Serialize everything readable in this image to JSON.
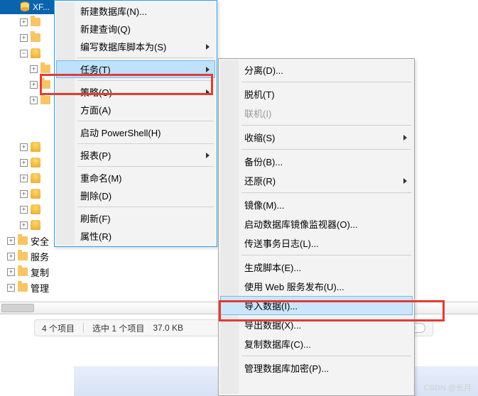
{
  "tree": {
    "top_selected": "XF...",
    "nodes_collapsed": [
      "",
      "",
      "",
      "",
      "",
      "",
      ""
    ],
    "folders": [
      {
        "label": "安全"
      },
      {
        "label": "服务"
      },
      {
        "label": "复制"
      },
      {
        "label": "管理"
      }
    ]
  },
  "menu1": {
    "items": [
      {
        "key": "new-db",
        "label": "新建数据库(N)...",
        "arrow": false
      },
      {
        "key": "new-query",
        "label": "新建查询(Q)",
        "arrow": false
      },
      {
        "key": "script-as",
        "label": "编写数据库脚本为(S)",
        "arrow": true
      }
    ],
    "tasks": {
      "label": "任务(T)"
    },
    "group2": [
      {
        "key": "policy",
        "label": "策略(O)",
        "arrow": true
      },
      {
        "key": "facets",
        "label": "方面(A)",
        "arrow": false
      }
    ],
    "powershell": {
      "label": "启动 PowerShell(H)"
    },
    "reports": {
      "label": "报表(P)"
    },
    "group3": [
      {
        "key": "rename",
        "label": "重命名(M)",
        "arrow": false
      },
      {
        "key": "delete",
        "label": "删除(D)",
        "arrow": false
      }
    ],
    "group4": [
      {
        "key": "refresh",
        "label": "刷新(F)",
        "arrow": false
      },
      {
        "key": "props",
        "label": "属性(R)",
        "arrow": false
      }
    ]
  },
  "menu2": {
    "g1": [
      {
        "key": "detach",
        "label": "分离(D)..."
      }
    ],
    "g2": [
      {
        "key": "offline",
        "label": "脱机(T)"
      },
      {
        "key": "online",
        "label": "联机(I)",
        "disabled": true
      }
    ],
    "g3": [
      {
        "key": "shrink",
        "label": "收缩(S)",
        "arrow": true
      }
    ],
    "g4": [
      {
        "key": "backup",
        "label": "备份(B)..."
      },
      {
        "key": "restore",
        "label": "还原(R)",
        "arrow": true
      }
    ],
    "g5": [
      {
        "key": "mirror",
        "label": "镜像(M)..."
      },
      {
        "key": "mirror-mon",
        "label": "启动数据库镜像监视器(O)..."
      },
      {
        "key": "ship-log",
        "label": "传送事务日志(L)..."
      }
    ],
    "g6": [
      {
        "key": "gen-script",
        "label": "生成脚本(E)..."
      },
      {
        "key": "web-publish",
        "label": "使用 Web 服务发布(U)..."
      },
      {
        "key": "import",
        "label": "导入数据(I)...",
        "highlight": true
      },
      {
        "key": "export",
        "label": "导出数据(X)..."
      },
      {
        "key": "copy-db",
        "label": "复制数据库(C)..."
      }
    ],
    "g7": [
      {
        "key": "manage-enc",
        "label": "管理数据库加密(P)..."
      }
    ]
  },
  "statusbar": {
    "count": "4 个项目",
    "selected": "选中 1 个项目",
    "size": "37.0 KB"
  },
  "watermark": "CSDN @长月."
}
